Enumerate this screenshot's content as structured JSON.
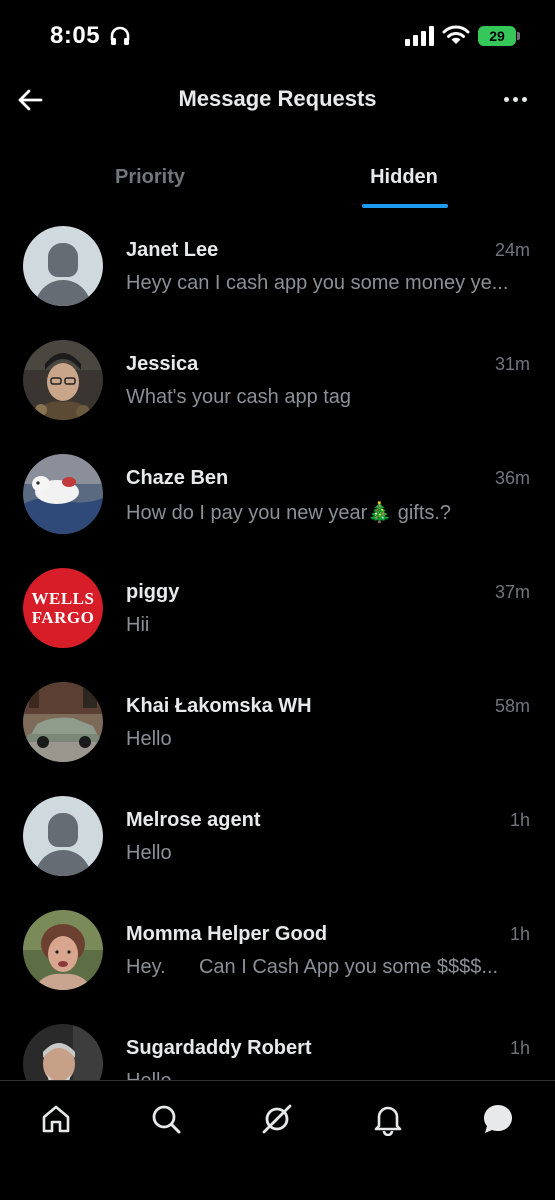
{
  "status_bar": {
    "time": "8:05",
    "battery": "29"
  },
  "header": {
    "title": "Message Requests",
    "back_icon": "arrow-left-icon",
    "more_icon": "more-horizontal-icon"
  },
  "tabs": [
    {
      "label": "Priority",
      "selected": false
    },
    {
      "label": "Hidden",
      "selected": true
    }
  ],
  "conversations": [
    {
      "name": "Janet Lee",
      "time": "24m",
      "preview": "Heyy can I cash app you some money ye...",
      "avatar": "default-avatar"
    },
    {
      "name": "Jessica",
      "time": "31m",
      "preview": "What's your cash app tag",
      "avatar": "photo-woman-glasses"
    },
    {
      "name": "Chaze Ben",
      "time": "36m",
      "preview": "How do I pay you new year🎄 gifts.?",
      "avatar": "photo-dog"
    },
    {
      "name": "piggy",
      "time": "37m",
      "preview": "Hii",
      "avatar": "wells-fargo-logo",
      "avatar_text": [
        "WELLS",
        "FARGO"
      ]
    },
    {
      "name": "Khai Łakomska WH",
      "time": "58m",
      "preview": "Hello",
      "avatar": "photo-green-car"
    },
    {
      "name": "Melrose agent",
      "time": "1h",
      "preview": "Hello",
      "avatar": "default-avatar"
    },
    {
      "name": "Momma Helper Good",
      "time": "1h",
      "preview": "Hey.      Can I Cash App you some $$$$...",
      "avatar": "photo-woman"
    },
    {
      "name": "Sugardaddy Robert",
      "time": "1h",
      "preview": "Hello",
      "avatar": "photo-man"
    }
  ],
  "bottom_nav": [
    {
      "icon": "home-icon",
      "active": false
    },
    {
      "icon": "search-icon",
      "active": false
    },
    {
      "icon": "grok-icon",
      "active": false
    },
    {
      "icon": "bell-icon",
      "active": false
    },
    {
      "icon": "messages-icon",
      "active": true
    }
  ],
  "colors": {
    "background": "#000000",
    "accent": "#1d9bf0",
    "primary_text": "#e7e9ea",
    "secondary_text": "#71767b",
    "battery": "#35c759"
  }
}
